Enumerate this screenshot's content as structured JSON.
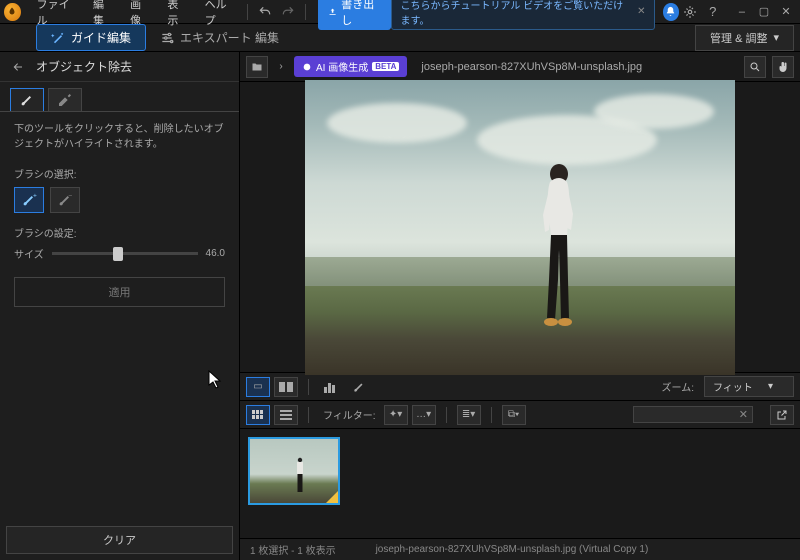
{
  "menu": {
    "file": "ファイル",
    "edit": "編集",
    "image": "画像",
    "view": "表示",
    "help": "ヘルプ"
  },
  "titlebar": {
    "export": "書き出し",
    "tutorial": "こちらからチュートリアル ビデオをご覧いただけます。"
  },
  "modes": {
    "guide": "ガイド編集",
    "expert": "エキスパート 編集",
    "manage": "管理 & 調整"
  },
  "sidebar": {
    "title": "オブジェクト除去",
    "hint": "下のツールをクリックすると、削除したいオブジェクトがハイライトされます。",
    "brush_select": "ブラシの選択:",
    "brush_settings": "ブラシの設定:",
    "size_label": "サイズ",
    "size_value": "46.0",
    "apply": "適用",
    "clear": "クリア"
  },
  "pathbar": {
    "ai": "AI 画像生成",
    "beta": "BETA",
    "filename": "joseph-pearson-827XUhVSp8M-unsplash.jpg"
  },
  "viewbar": {
    "zoom_label": "ズーム:",
    "zoom_value": "フィット"
  },
  "filterbar": {
    "filter_label": "フィルター:"
  },
  "status": {
    "selection": "1 枚選択 - 1 枚表示",
    "filename": "joseph-pearson-827XUhVSp8M-unsplash.jpg (Virtual Copy 1)"
  }
}
